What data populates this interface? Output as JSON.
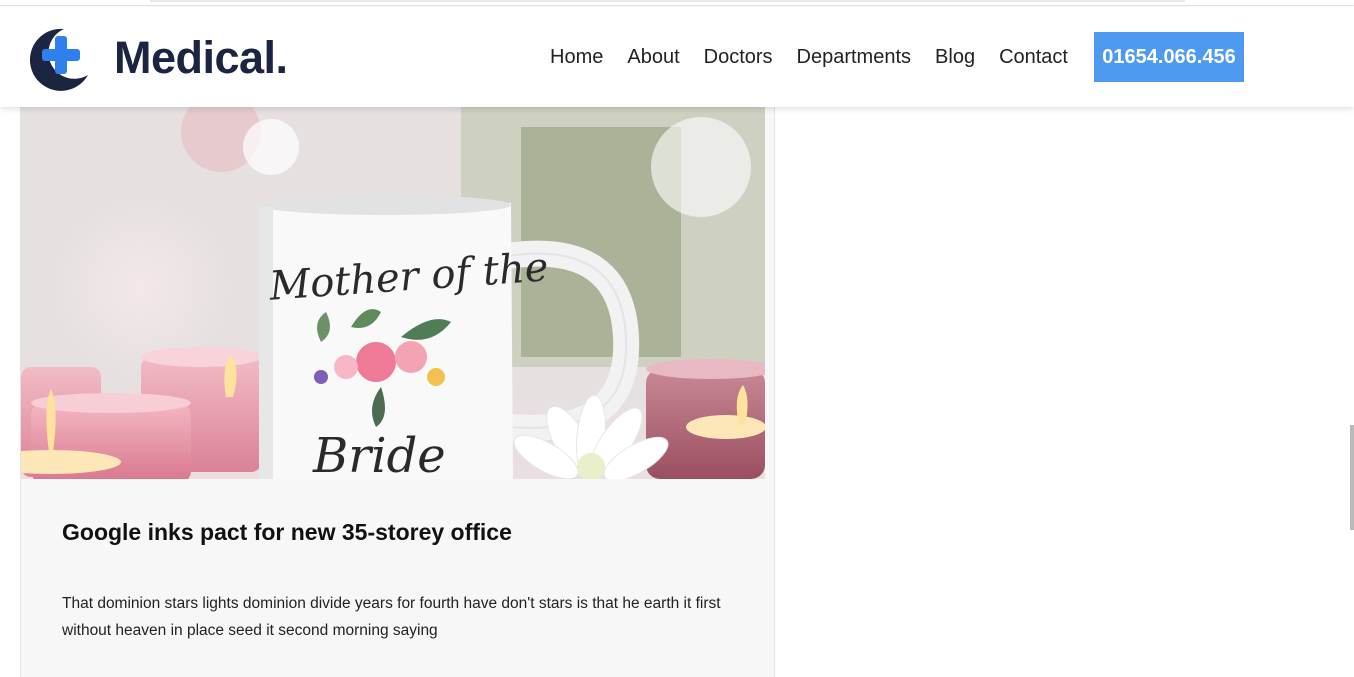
{
  "header": {
    "logo_text": "Medical.",
    "nav": [
      {
        "label": "Home"
      },
      {
        "label": "About"
      },
      {
        "label": "Doctors"
      },
      {
        "label": "Departments"
      },
      {
        "label": "Blog"
      },
      {
        "label": "Contact"
      }
    ],
    "phone": "01654.066.456"
  },
  "colors": {
    "brand_navy": "#1b2440",
    "accent_blue": "#4d9af0"
  },
  "post": {
    "image_mug_text_line1": "Mother of the",
    "image_mug_text_line2": "Bride",
    "title": "Google inks pact for new 35-storey office",
    "excerpt": "That dominion stars lights dominion divide years for fourth have don't stars is that he earth it first without heaven in place seed it second morning saying"
  }
}
